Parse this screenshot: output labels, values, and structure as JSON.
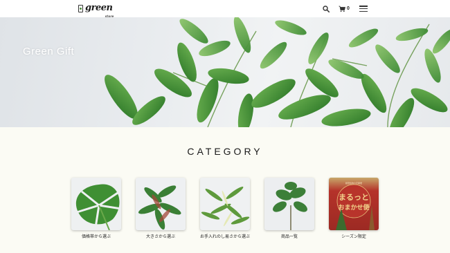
{
  "header": {
    "logo_text": "green",
    "logo_sub": "store",
    "cart_count": "0",
    "icons": [
      "search-icon",
      "cart-icon",
      "menu-icon"
    ]
  },
  "hero": {
    "title": "Green Gift"
  },
  "category": {
    "title": "CATEGORY",
    "items": [
      {
        "label": "価格帯から選ぶ"
      },
      {
        "label": "大きさから選ぶ"
      },
      {
        "label": "お手入れのし易さから選ぶ"
      },
      {
        "label": "商品一覧"
      },
      {
        "label": "シーズン限定"
      }
    ]
  },
  "season_card": {
    "small_text": "観葉植物の定期便",
    "big_text_1": "まるっと",
    "big_text_2": "おまかせ便"
  },
  "colors": {
    "accent": "#e0a12c",
    "leaf": "#4f9a3c",
    "season_red": "#b5322a"
  }
}
